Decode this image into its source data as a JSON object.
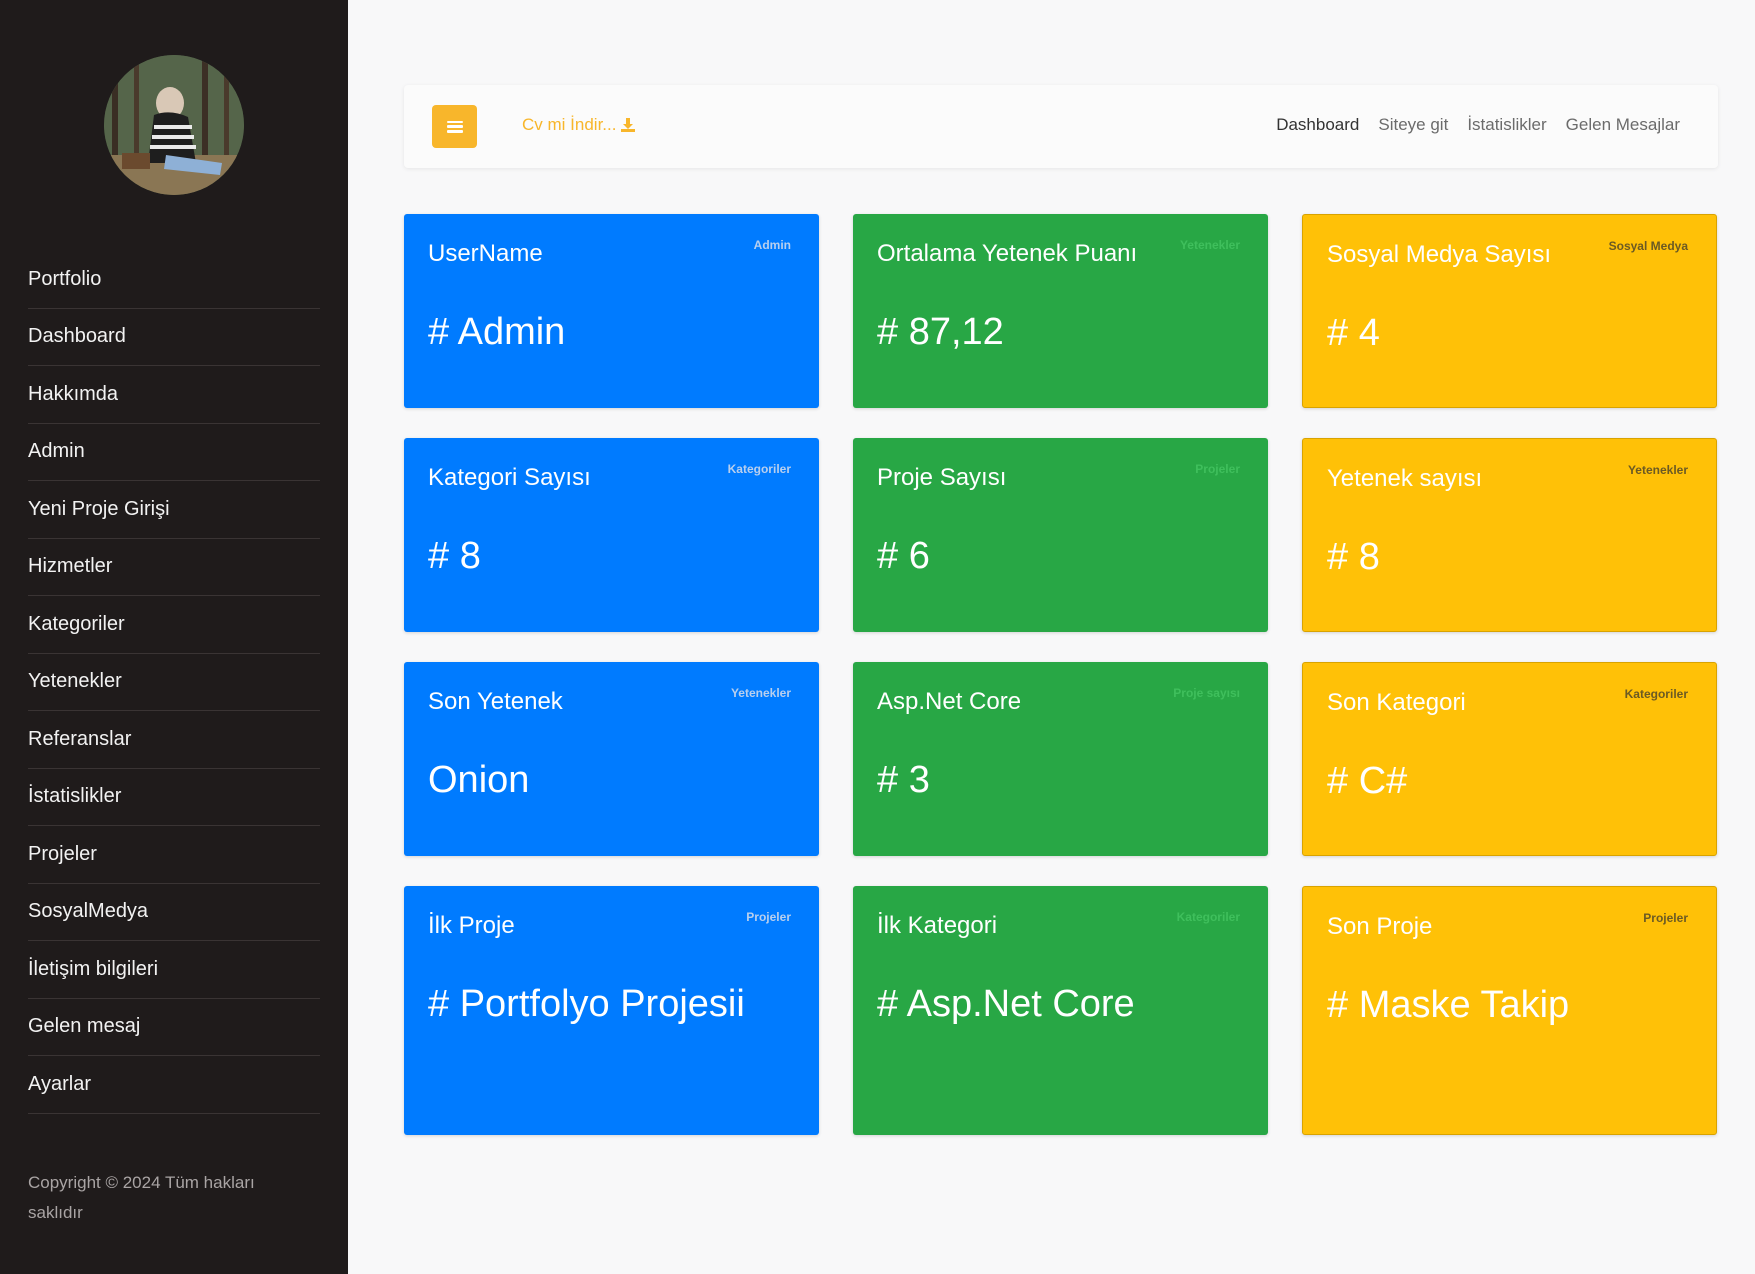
{
  "sidebar": {
    "items": [
      {
        "label": "Portfolio"
      },
      {
        "label": "Dashboard"
      },
      {
        "label": "Hakkımda"
      },
      {
        "label": "Admin"
      },
      {
        "label": "Yeni Proje Girişi"
      },
      {
        "label": "Hizmetler"
      },
      {
        "label": "Kategoriler"
      },
      {
        "label": "Yetenekler"
      },
      {
        "label": "Referanslar"
      },
      {
        "label": "İstatislikler"
      },
      {
        "label": "Projeler"
      },
      {
        "label": "SosyalMedya"
      },
      {
        "label": "İletişim bilgileri"
      },
      {
        "label": "Gelen mesaj"
      },
      {
        "label": "Ayarlar"
      }
    ],
    "copyright": "Copyright © 2024 Tüm hakları saklıdır"
  },
  "topbar": {
    "cv_link": "Cv mi İndir...",
    "nav": [
      {
        "label": "Dashboard"
      },
      {
        "label": "Siteye git"
      },
      {
        "label": "İstatislikler"
      },
      {
        "label": "Gelen Mesajlar"
      }
    ]
  },
  "cards": [
    {
      "title": "UserName",
      "tag": "Admin",
      "value": "# Admin"
    },
    {
      "title": "Ortalama Yetenek Puanı",
      "tag": "Yetenekler",
      "value": "# 87,12"
    },
    {
      "title": "Sosyal Medya Sayısı",
      "tag": "Sosyal Medya",
      "value": "# 4"
    },
    {
      "title": "Kategori Sayısı",
      "tag": "Kategoriler",
      "value": "# 8"
    },
    {
      "title": "Proje Sayısı",
      "tag": "Projeler",
      "value": "# 6"
    },
    {
      "title": "Yetenek sayısı",
      "tag": "Yetenekler",
      "value": "# 8"
    },
    {
      "title": "Son Yetenek",
      "tag": "Yetenekler",
      "value": "Onion"
    },
    {
      "title": "Asp.Net Core",
      "tag": "Proje sayısı",
      "value": "# 3"
    },
    {
      "title": "Son Kategori",
      "tag": "Kategoriler",
      "value": "# C#"
    },
    {
      "title": "İlk Proje",
      "tag": "Projeler",
      "value": "# Portfolyo Projesii"
    },
    {
      "title": "İlk Kategori",
      "tag": "Kategoriler",
      "value": "# Asp.Net Core"
    },
    {
      "title": "Son Proje",
      "tag": "Projeler",
      "value": "# Maske Takip"
    }
  ],
  "colors": {
    "blue": "#007bff",
    "green": "#28a745",
    "yellow": "#ffc107",
    "accent": "#f8b62b",
    "sidebar": "#1f1b1b"
  }
}
